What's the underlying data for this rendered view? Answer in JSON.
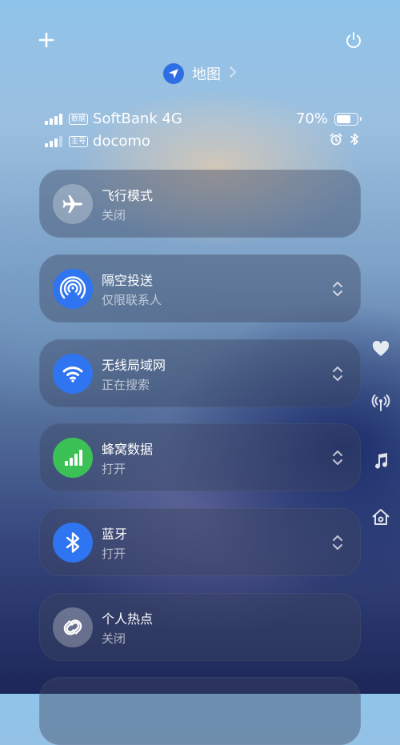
{
  "header": {
    "location_label": "地图"
  },
  "status": {
    "carrier1": {
      "tag": "数据",
      "name": "SoftBank 4G"
    },
    "carrier2": {
      "tag": "主号",
      "name": "docomo"
    },
    "battery_percent": "70%",
    "battery_level": 0.7
  },
  "cards": [
    {
      "title": "飞行模式",
      "subtitle": "关闭",
      "icon": "airplane-icon",
      "icon_bg": "rgba(255,255,255,0.28)"
    },
    {
      "title": "隔空投送",
      "subtitle": "仅限联系人",
      "icon": "airdrop-icon",
      "icon_bg": "#2f74f0"
    },
    {
      "title": "无线局域网",
      "subtitle": "正在搜索",
      "icon": "wifi-icon",
      "icon_bg": "#2f74f0"
    },
    {
      "title": "蜂窝数据",
      "subtitle": "打开",
      "icon": "cellular-icon",
      "icon_bg": "#3cc157"
    },
    {
      "title": "蓝牙",
      "subtitle": "打开",
      "icon": "bluetooth-icon",
      "icon_bg": "#2f74f0"
    },
    {
      "title": "个人热点",
      "subtitle": "关闭",
      "icon": "hotspot-icon",
      "icon_bg": "rgba(255,255,255,0.28)"
    }
  ],
  "side_icons": [
    "heart-icon",
    "antenna-icon",
    "music-icon",
    "home-icon"
  ]
}
